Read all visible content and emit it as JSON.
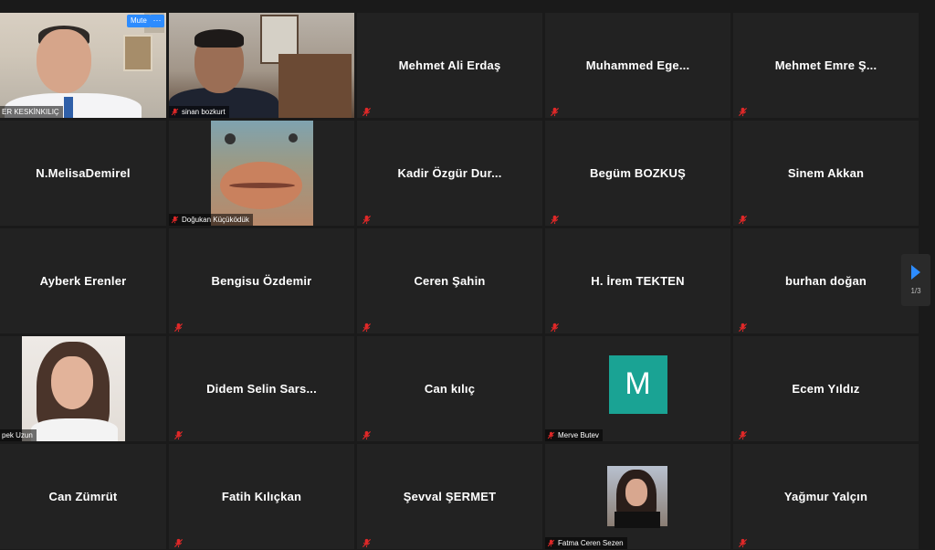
{
  "tiles": [
    {
      "name": "",
      "caption": "ER KESKİNKILIÇ",
      "type": "video-man1"
    },
    {
      "name": "",
      "caption": "sinan bozkurt",
      "type": "video-man2",
      "active": true
    },
    {
      "name": "Mehmet Ali Erdaş"
    },
    {
      "name": "Muhammed  Ege..."
    },
    {
      "name": "Mehmet Emre Ş..."
    },
    {
      "name": "N.MelisaDemirel",
      "nomic": true
    },
    {
      "name": "",
      "caption": "Doğukan Küçüködük",
      "type": "video-fish"
    },
    {
      "name": "Kadir Özgür Dur..."
    },
    {
      "name": "Begüm BOZKUŞ"
    },
    {
      "name": "Sinem Akkan"
    },
    {
      "name": "Ayberk Erenler",
      "nomic": true
    },
    {
      "name": "Bengisu Özdemir"
    },
    {
      "name": "Ceren Şahin"
    },
    {
      "name": "H. İrem TEKTEN"
    },
    {
      "name": "burhan doğan"
    },
    {
      "name": "",
      "caption": "pek Uzun",
      "type": "video-girl1",
      "nomic": true
    },
    {
      "name": "Didem  Selin  Sars..."
    },
    {
      "name": "Can kılıç"
    },
    {
      "name": "",
      "caption": "Merve Butev",
      "type": "avatar"
    },
    {
      "name": "Ecem Yıldız"
    },
    {
      "name": "Can Zümrüt",
      "nomic": true
    },
    {
      "name": "Fatih Kılıçkan"
    },
    {
      "name": "Şevval ŞERMET"
    },
    {
      "name": "",
      "caption": "Fatma Ceren Sezen",
      "type": "video-girl2"
    },
    {
      "name": "Yağmur Yalçın"
    }
  ],
  "controls": {
    "mute_label": "Mute",
    "more_label": "···",
    "avatar_letter": "M",
    "page_indicator": "1/3"
  },
  "colors": {
    "accent": "#2d8cff",
    "active_speaker": "#c8e04a",
    "muted_mic": "#e02828",
    "avatar_bg": "#1aa394"
  }
}
